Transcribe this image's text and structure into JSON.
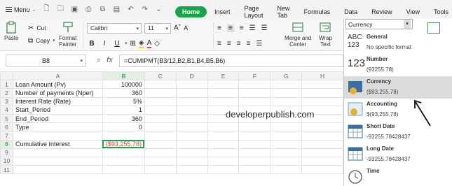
{
  "menu": {
    "label": "Menu"
  },
  "tabs": [
    {
      "label": "Home",
      "active": true
    },
    {
      "label": "Insert"
    },
    {
      "label": "Page Layout"
    },
    {
      "label": "New Tab"
    },
    {
      "label": "Formulas"
    },
    {
      "label": "Data"
    },
    {
      "label": "Review"
    },
    {
      "label": "View"
    },
    {
      "label": "Tools"
    }
  ],
  "ribbon": {
    "paste": "Paste",
    "cut": "Cut",
    "copy": "Copy",
    "format_painter_1": "Format",
    "format_painter_2": "Painter",
    "font_name": "Calibri",
    "font_size": "11",
    "merge_1": "Merge and",
    "merge_2": "Center",
    "wrap_1": "Wrap",
    "wrap_2": "Text",
    "number_format": "Currency"
  },
  "formula_bar": {
    "name_box": "B8",
    "fx": "fx",
    "formula": "=CUMIPMT(B3/12,B2,B1,B4,B5,B6)"
  },
  "sheet": {
    "columns": [
      "A",
      "B",
      "C",
      "D",
      "E",
      "F",
      "G",
      "H"
    ],
    "rows": [
      {
        "n": "1",
        "a": "Loan Amount (Pv)",
        "b": "100000"
      },
      {
        "n": "2",
        "a": "Number of payments (Nper)",
        "b": "360"
      },
      {
        "n": "3",
        "a": "Interest Rate (Rate)",
        "b": "5%"
      },
      {
        "n": "4",
        "a": "Start_Period",
        "b": "1"
      },
      {
        "n": "5",
        "a": "End_Period",
        "b": "360"
      },
      {
        "n": "6",
        "a": "Type",
        "b": "0"
      },
      {
        "n": "7",
        "a": "",
        "b": ""
      },
      {
        "n": "8",
        "a": "Cumulative Interest",
        "b": "($93,255.78)"
      },
      {
        "n": "9",
        "a": "",
        "b": ""
      },
      {
        "n": "10",
        "a": "",
        "b": ""
      },
      {
        "n": "11",
        "a": "",
        "b": ""
      }
    ],
    "watermark": "developerpublish.com",
    "accent": "#1aa34a",
    "negative_color": "#e23b3b"
  },
  "format_panel": {
    "items": [
      {
        "name": "General",
        "sample": "No specific format",
        "icon": "general-format-icon"
      },
      {
        "name": "Number",
        "sample": "(93255.78)",
        "icon": "number-format-icon"
      },
      {
        "name": "Currency",
        "sample": "($93,255.78)",
        "icon": "currency-format-icon",
        "highlighted": true
      },
      {
        "name": "Accounting",
        "sample": "$(93,255.78)",
        "icon": "accounting-format-icon"
      },
      {
        "name": "Short Date",
        "sample": "-93255.78428437",
        "icon": "short-date-icon"
      },
      {
        "name": "Long Date",
        "sample": "-93255.78428437",
        "icon": "long-date-icon"
      },
      {
        "name": "Time",
        "sample": "",
        "icon": "clock-icon"
      }
    ]
  }
}
